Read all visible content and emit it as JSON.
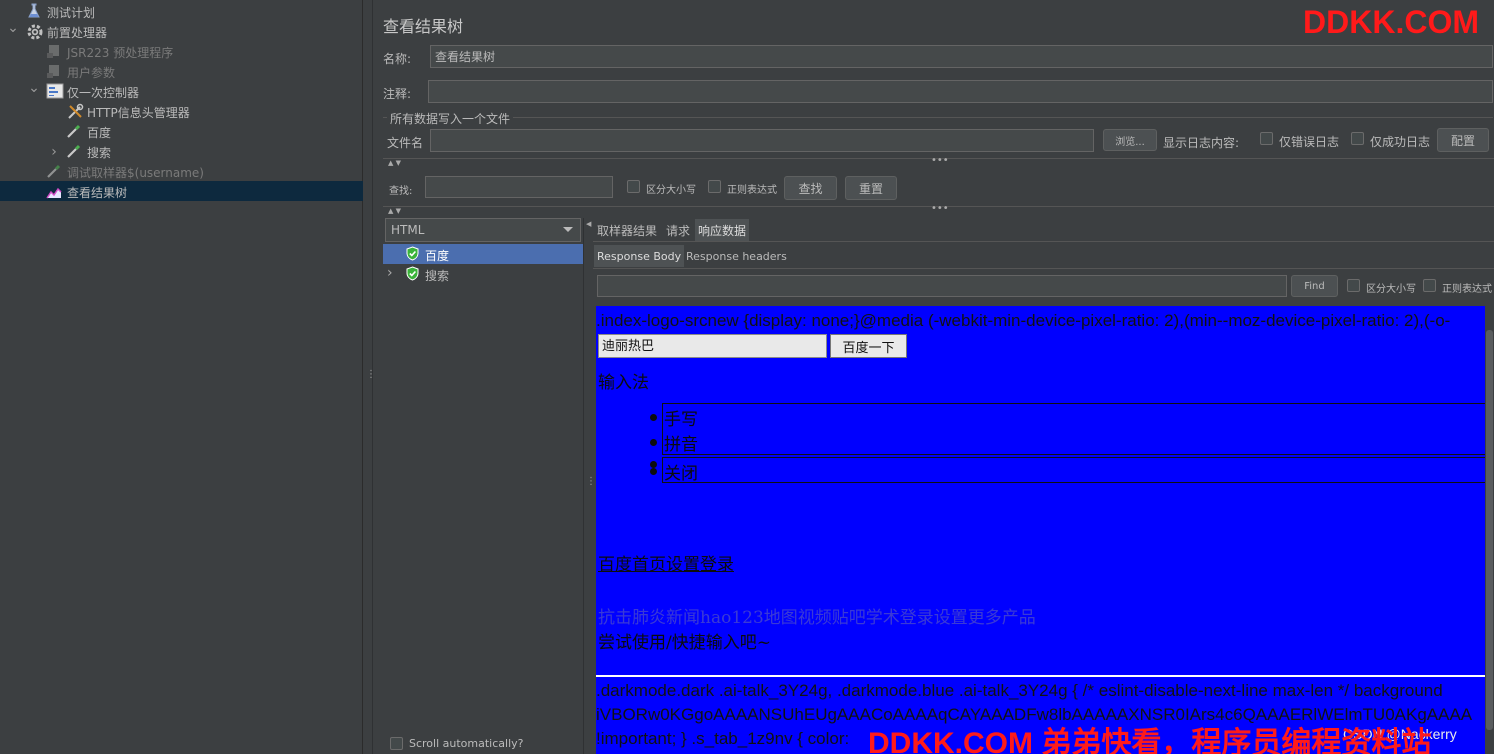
{
  "tree": {
    "items": [
      {
        "label": "测试计划",
        "icon": "flask-icon",
        "level": 0,
        "arrow": "",
        "state": "normal"
      },
      {
        "label": "前置处理器",
        "icon": "gear-icon",
        "level": 0,
        "arrow": "expanded",
        "state": "normal"
      },
      {
        "label": "JSR223 预处理程序",
        "icon": "script-icon",
        "level": 1,
        "arrow": "",
        "state": "disabled"
      },
      {
        "label": "用户参数",
        "icon": "script-icon",
        "level": 1,
        "arrow": "",
        "state": "disabled"
      },
      {
        "label": "仅一次控制器",
        "icon": "controller-icon",
        "level": 1,
        "arrow": "expanded",
        "state": "normal"
      },
      {
        "label": "HTTP信息头管理器",
        "icon": "tools-icon",
        "level": 2,
        "arrow": "",
        "state": "normal"
      },
      {
        "label": "百度",
        "icon": "pipette-icon",
        "level": 2,
        "arrow": "",
        "state": "normal"
      },
      {
        "label": "搜索",
        "icon": "pipette-icon",
        "level": 2,
        "arrow": "collapsed",
        "state": "normal"
      },
      {
        "label": "调试取样器$(username)",
        "icon": "pipette-icon",
        "level": 1,
        "arrow": "",
        "state": "disabled"
      },
      {
        "label": "查看结果树",
        "icon": "chart-icon",
        "level": 1,
        "arrow": "",
        "state": "selected"
      }
    ]
  },
  "panel": {
    "title": "查看结果树",
    "name_label": "名称:",
    "name_value": "查看结果树",
    "comment_label": "注释:",
    "comment_value": "",
    "file_group_title": "所有数据写入一个文件",
    "file_label": "文件名",
    "file_value": "",
    "browse_label": "浏览...",
    "log_content_label": "显示日志内容:",
    "errors_only_label": "仅错误日志",
    "success_only_label": "仅成功日志",
    "configure_label": "配置"
  },
  "search": {
    "label": "查找:",
    "value": "",
    "case_label": "区分大小写",
    "regex_label": "正则表达式",
    "find_label": "查找",
    "reset_label": "重置"
  },
  "results": {
    "renderer": "HTML",
    "samples": [
      {
        "label": "百度",
        "status": "success",
        "selected": true,
        "arrow": ""
      },
      {
        "label": "搜索",
        "status": "success",
        "selected": false,
        "arrow": "collapsed"
      }
    ],
    "scroll_label": "Scroll automatically?",
    "scroll_checked": false
  },
  "detail": {
    "tabs": [
      "取样器结果",
      "请求",
      "响应数据"
    ],
    "active_tab": "响应数据",
    "subtabs": [
      "Response Body",
      "Response headers"
    ],
    "active_subtab": "Response Body",
    "find_value": "",
    "find_label": "Find",
    "case_label": "区分大小写",
    "regex_label": "正则表达式"
  },
  "html_view": {
    "line1": ".index-logo-srcnew {display: none;}@media (-webkit-min-device-pixel-ratio: 2),(min--moz-device-pixel-ratio: 2),(-o-",
    "search_value": "迪丽热巴",
    "search_button": "百度一下",
    "ime_label": "输入法",
    "ime_items": [
      "手写",
      "拼音",
      "",
      "关闭"
    ],
    "nav_links": "百度首页设置登录",
    "links_line": "抗击肺炎新闻hao123地图视频贴吧学术登录设置更多产品",
    "hint_line": "尝试使用/快捷输入吧~",
    "css_line1": ".darkmode.dark .ai-talk_3Y24g, .darkmode.blue .ai-talk_3Y24g { /* eslint-disable-next-line max-len */ background",
    "css_line2": "iVBORw0KGgoAAAANSUhEUgAAACoAAAAqCAYAAADFw8lbAAAAAXNSR0IArs4c6QAAAERlWElmTU0AKgAAAA",
    "css_line3": "!important; } .s_tab_1z9nv { color:",
    "css_tail": "CSDN @Nackerry"
  },
  "watermarks": {
    "top": "DDKK.COM",
    "bottom": "DDKK.COM 弟弟快看，程序员编程资料站"
  },
  "colors": {
    "background": "#3c3f41",
    "selection": "#0d293e",
    "response_bg": "#0000ff",
    "watermark": "#ff1a1a",
    "success": "#3bb33b"
  }
}
